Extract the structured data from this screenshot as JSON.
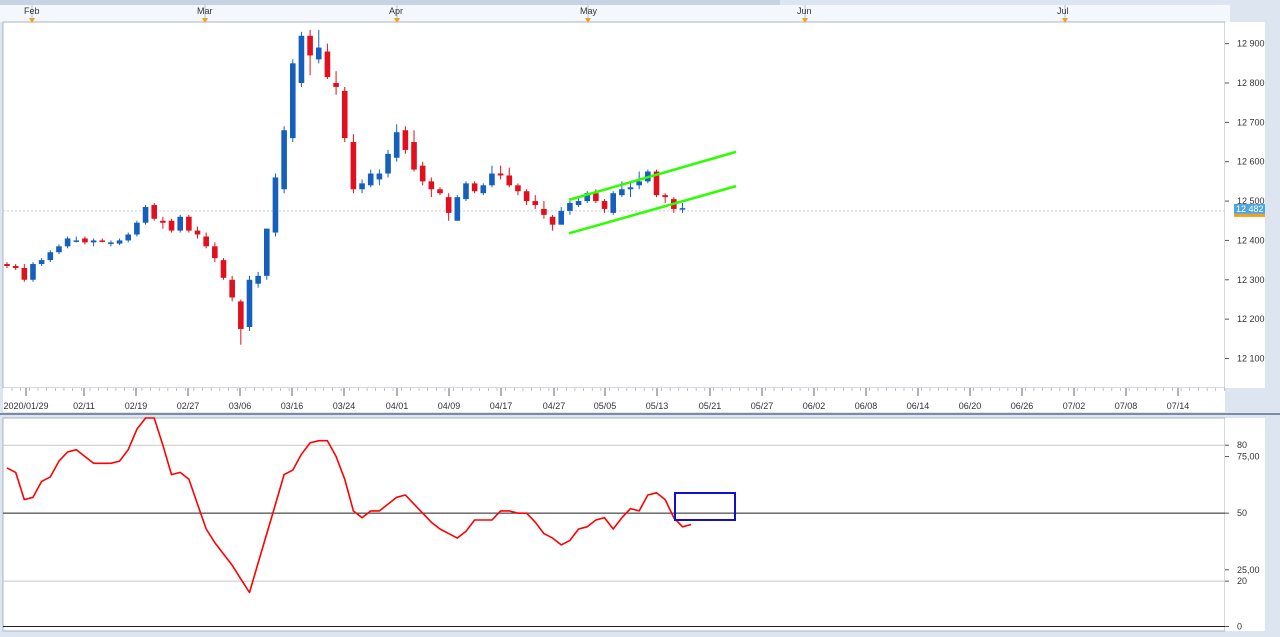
{
  "chart_data": [
    {
      "type": "candlestick",
      "title": "",
      "months": [
        "Feb",
        "Mar",
        "Apr",
        "May",
        "Jun",
        "Jul"
      ],
      "date_ticks": [
        "2020/01/29",
        "02/11",
        "02/19",
        "02/27",
        "03/06",
        "03/16",
        "03/24",
        "04/01",
        "04/09",
        "04/17",
        "04/27",
        "05/05",
        "05/13",
        "05/21",
        "05/27",
        "06/02",
        "06/08",
        "06/14",
        "06/20",
        "06/26",
        "07/02",
        "07/08",
        "07/14"
      ],
      "y_ticks": [
        "12 900",
        "12 800",
        "12 700",
        "12 600",
        "12 500",
        "12 400",
        "12 300",
        "12 200",
        "12 100"
      ],
      "ylim": [
        12025,
        12955
      ],
      "last_price": 12475,
      "last_price_label": "12 482",
      "ohlc": [
        [
          12340,
          12345,
          12330,
          12335
        ],
        [
          12335,
          12340,
          12325,
          12330
        ],
        [
          12330,
          12340,
          12295,
          12300
        ],
        [
          12300,
          12345,
          12295,
          12340
        ],
        [
          12340,
          12355,
          12335,
          12350
        ],
        [
          12350,
          12375,
          12345,
          12370
        ],
        [
          12370,
          12390,
          12365,
          12385
        ],
        [
          12385,
          12410,
          12380,
          12405
        ],
        [
          12400,
          12410,
          12395,
          12400
        ],
        [
          12405,
          12410,
          12390,
          12395
        ],
        [
          12395,
          12405,
          12385,
          12400
        ],
        [
          12400,
          12405,
          12395,
          12398
        ],
        [
          12395,
          12400,
          12385,
          12395
        ],
        [
          12392,
          12405,
          12388,
          12400
        ],
        [
          12400,
          12420,
          12395,
          12415
        ],
        [
          12415,
          12450,
          12410,
          12445
        ],
        [
          12445,
          12490,
          12440,
          12485
        ],
        [
          12490,
          12495,
          12450,
          12455
        ],
        [
          12450,
          12460,
          12430,
          12445
        ],
        [
          12450,
          12455,
          12420,
          12425
        ],
        [
          12425,
          12465,
          12420,
          12460
        ],
        [
          12460,
          12465,
          12420,
          12425
        ],
        [
          12425,
          12435,
          12405,
          12415
        ],
        [
          12410,
          12420,
          12380,
          12385
        ],
        [
          12385,
          12395,
          12345,
          12355
        ],
        [
          12350,
          12355,
          12300,
          12305
        ],
        [
          12300,
          12310,
          12245,
          12255
        ],
        [
          12245,
          12250,
          12135,
          12175
        ],
        [
          12180,
          12310,
          12170,
          12300
        ],
        [
          12290,
          12320,
          12280,
          12310
        ],
        [
          12310,
          12430,
          12300,
          12430
        ],
        [
          12420,
          12570,
          12410,
          12560
        ],
        [
          12530,
          12690,
          12520,
          12680
        ],
        [
          12660,
          12860,
          12650,
          12850
        ],
        [
          12800,
          12930,
          12790,
          12920
        ],
        [
          12920,
          12935,
          12820,
          12870
        ],
        [
          12860,
          12935,
          12850,
          12890
        ],
        [
          12880,
          12900,
          12810,
          12815
        ],
        [
          12800,
          12830,
          12770,
          12790
        ],
        [
          12780,
          12790,
          12650,
          12660
        ],
        [
          12650,
          12670,
          12520,
          12530
        ],
        [
          12530,
          12555,
          12520,
          12545
        ],
        [
          12540,
          12580,
          12535,
          12570
        ],
        [
          12555,
          12580,
          12540,
          12570
        ],
        [
          12570,
          12630,
          12560,
          12620
        ],
        [
          12610,
          12695,
          12600,
          12675
        ],
        [
          12680,
          12690,
          12620,
          12630
        ],
        [
          12650,
          12680,
          12575,
          12580
        ],
        [
          12590,
          12600,
          12540,
          12550
        ],
        [
          12550,
          12560,
          12510,
          12530
        ],
        [
          12530,
          12535,
          12515,
          12520
        ],
        [
          12510,
          12520,
          12450,
          12470
        ],
        [
          12450,
          12515,
          12450,
          12510
        ],
        [
          12505,
          12550,
          12500,
          12545
        ],
        [
          12545,
          12550,
          12520,
          12525
        ],
        [
          12520,
          12545,
          12515,
          12540
        ],
        [
          12540,
          12590,
          12535,
          12570
        ],
        [
          12570,
          12590,
          12555,
          12565
        ],
        [
          12565,
          12585,
          12535,
          12540
        ],
        [
          12540,
          12545,
          12515,
          12525
        ],
        [
          12525,
          12530,
          12490,
          12500
        ],
        [
          12500,
          12515,
          12480,
          12490
        ],
        [
          12480,
          12500,
          12455,
          12465
        ],
        [
          12460,
          12465,
          12425,
          12440
        ],
        [
          12440,
          12485,
          12440,
          12475
        ],
        [
          12475,
          12500,
          12465,
          12495
        ],
        [
          12490,
          12510,
          12485,
          12500
        ],
        [
          12500,
          12525,
          12495,
          12520
        ],
        [
          12520,
          12530,
          12495,
          12500
        ],
        [
          12500,
          12505,
          12470,
          12480
        ],
        [
          12470,
          12525,
          12465,
          12520
        ],
        [
          12515,
          12550,
          12510,
          12530
        ],
        [
          12530,
          12545,
          12510,
          12535
        ],
        [
          12540,
          12575,
          12530,
          12550
        ],
        [
          12550,
          12580,
          12545,
          12575
        ],
        [
          12575,
          12580,
          12510,
          12515
        ],
        [
          12515,
          12520,
          12495,
          12510
        ],
        [
          12505,
          12510,
          12470,
          12480
        ],
        [
          12482,
          12495,
          12470,
          12482
        ]
      ],
      "channel_lines": [
        {
          "color": "#2bff00",
          "points": [
            [
              12500,
              12500
            ],
            [
              12535,
              12625
            ]
          ]
        },
        {
          "color": "#2bff00",
          "points": [
            [
              12420,
              12420
            ],
            [
              12535,
              12538
            ]
          ]
        }
      ],
      "colors": {
        "up": "#1560bd",
        "down": "#e0101e",
        "channel": "#2bff00"
      }
    },
    {
      "type": "line",
      "title": "",
      "y_ticks": [
        "80",
        "75,00",
        "50",
        "25,00",
        "20",
        "0"
      ],
      "ylim": [
        -2,
        92
      ],
      "reference_lines": [
        80,
        50,
        20,
        0
      ],
      "series": [
        {
          "values": [
            70,
            68,
            56,
            57,
            64,
            66,
            73,
            77,
            78,
            75,
            72,
            72,
            72,
            73,
            78,
            87,
            92,
            92,
            80,
            67,
            68,
            65,
            54,
            43,
            37,
            32,
            27,
            21,
            15,
            28,
            41,
            54,
            67,
            69,
            76,
            81,
            82,
            82,
            75,
            65,
            51,
            48,
            51,
            51,
            54,
            57,
            58,
            54,
            50,
            46,
            43,
            41,
            39,
            42,
            47,
            47,
            47,
            51,
            51,
            50,
            50,
            46,
            41,
            39,
            36,
            38,
            43,
            44,
            47,
            48,
            43,
            48,
            52,
            51,
            58,
            59,
            56,
            48,
            44,
            45
          ]
        }
      ],
      "colors": {
        "line": "#ff0000",
        "highlight_box": "#1111cc"
      }
    }
  ]
}
